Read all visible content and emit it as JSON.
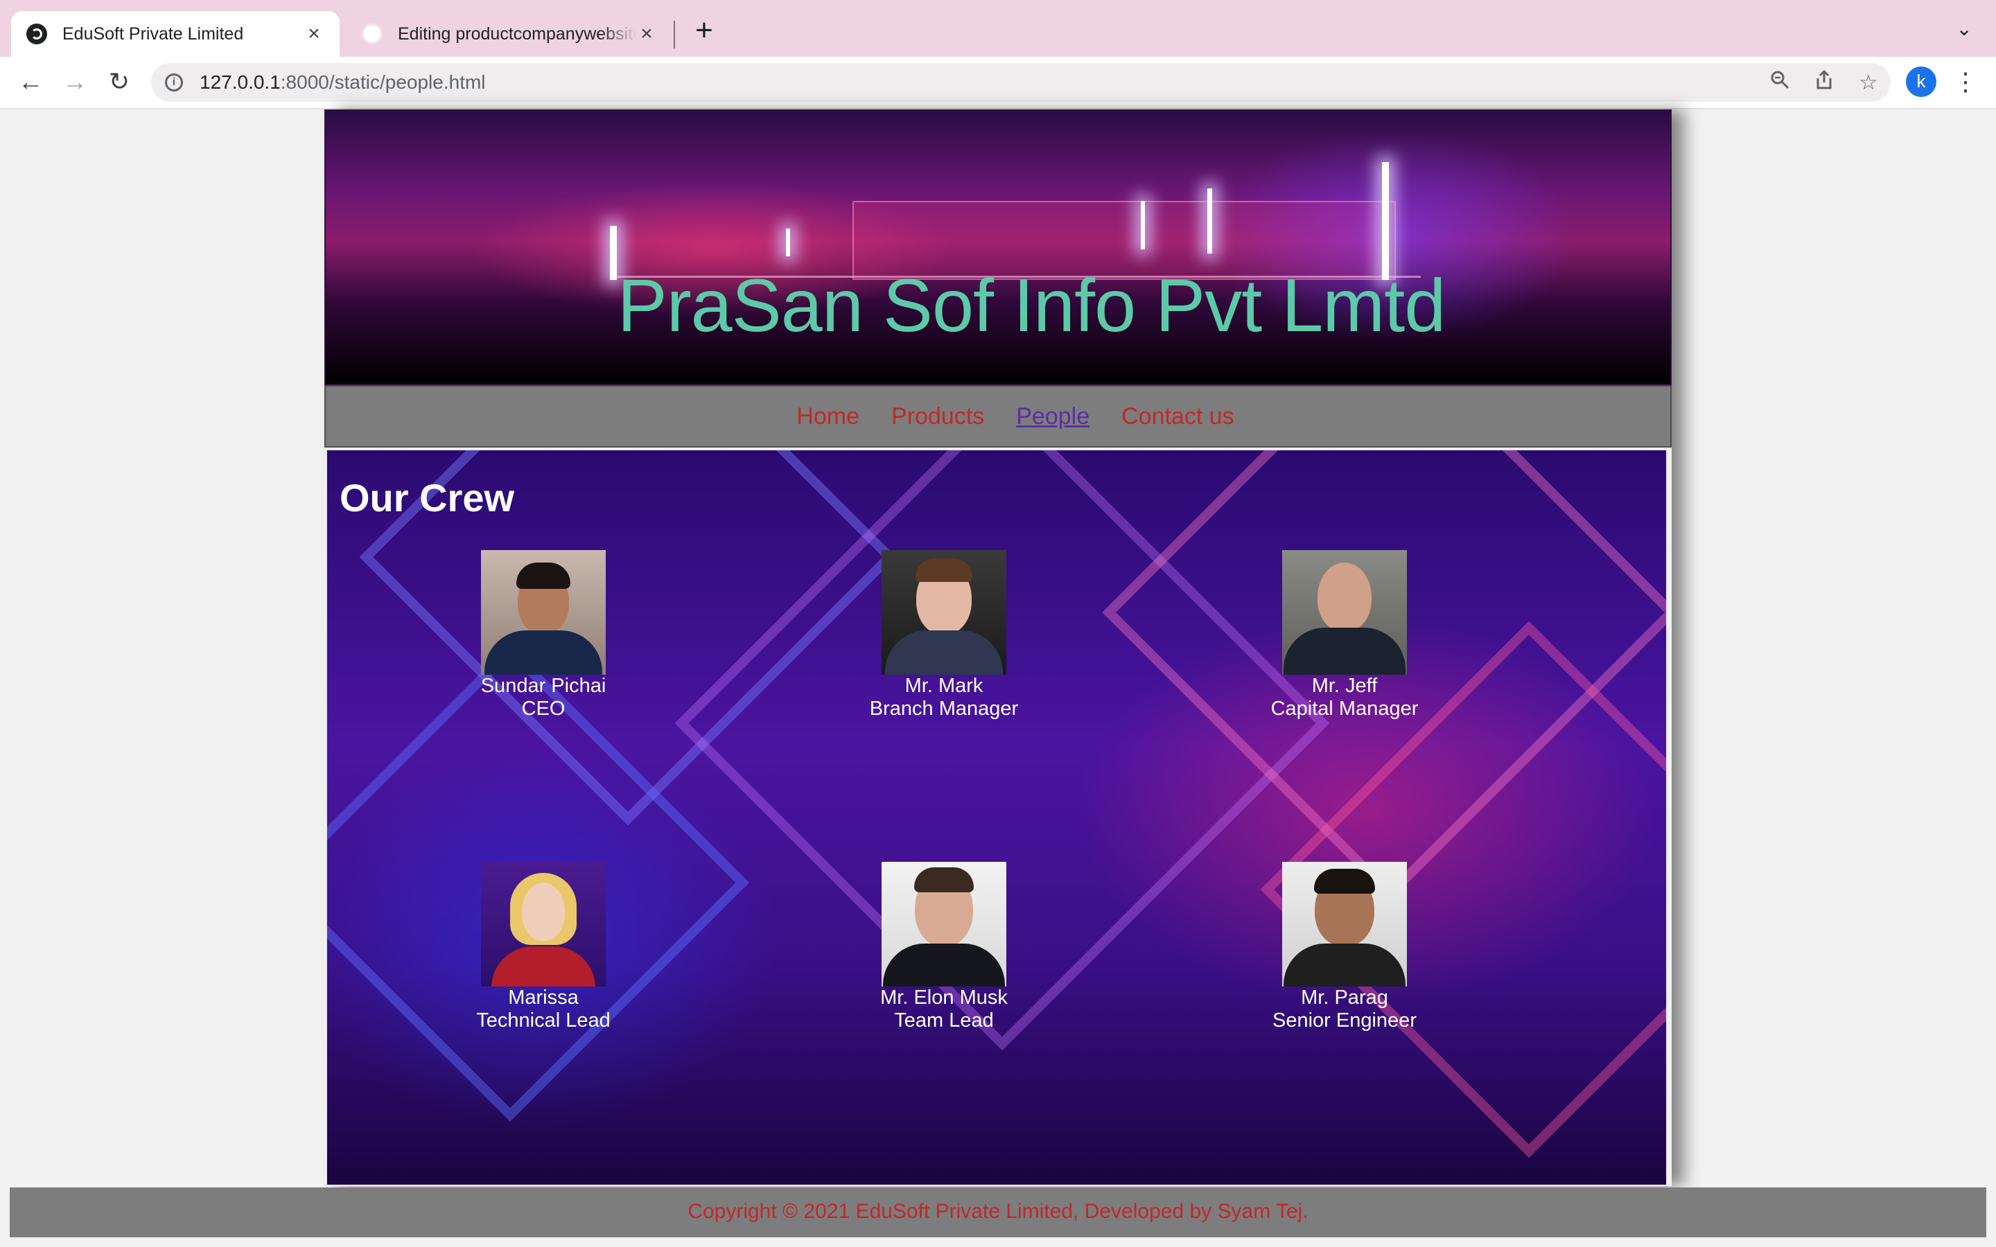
{
  "browser": {
    "tabs": [
      {
        "title": "EduSoft Private Limited",
        "active": true
      },
      {
        "title": "Editing productcompanywebsite",
        "active": false
      }
    ],
    "url_host": "127.0.0.1",
    "url_path": ":8000/static/people.html",
    "profile_initial": "k"
  },
  "site": {
    "brand": "PraSan Sof Info Pvt Lmtd",
    "nav": [
      "Home",
      "Products",
      "People",
      "Contact us"
    ],
    "current_nav": "People"
  },
  "crew": {
    "heading": "Our Crew",
    "members": [
      {
        "name": "Sundar Pichai",
        "role": "CEO"
      },
      {
        "name": "Mr. Mark",
        "role": "Branch Manager"
      },
      {
        "name": "Mr. Jeff",
        "role": "Capital Manager"
      },
      {
        "name": "Marissa",
        "role": "Technical Lead"
      },
      {
        "name": "Mr. Elon Musk",
        "role": "Team Lead"
      },
      {
        "name": "Mr. Parag",
        "role": "Senior Engineer"
      }
    ]
  },
  "footer": {
    "text": "Copyright © 2021 EduSoft Private Limited, Developed by Syam Tej."
  }
}
